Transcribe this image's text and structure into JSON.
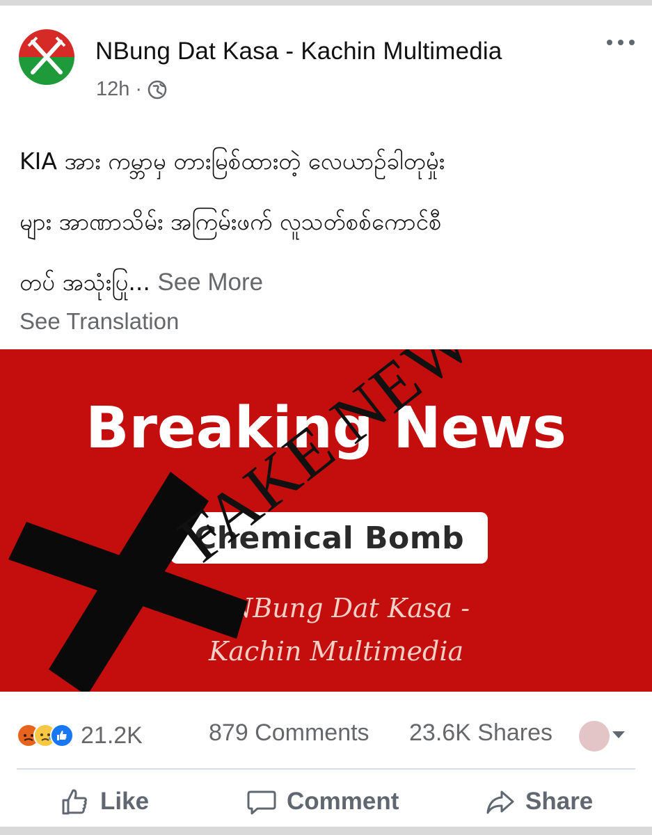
{
  "post": {
    "page_name": "NBung Dat Kasa - Kachin Multimedia",
    "time": "12h",
    "separator": "·",
    "text_lines": [
      "KIA အား ကမ္ဘာမှ တားမြစ်ထားတဲ့ လေယာဉ်ခါတုမှုံး",
      "များ အာဏာသိမ်း အကြမ်းဖက် လူသတ်စစ်ကောင်စီ",
      "တပ် အသုံးပြု..."
    ],
    "see_more": "See More",
    "see_translation": "See Translation"
  },
  "media": {
    "headline": "Breaking News",
    "pill_text": "Chemical Bomb",
    "credit_line1": "NBung Dat Kasa -",
    "credit_line2": "Kachin Multimedia",
    "stamp_text": "FAKE NEWS"
  },
  "stats": {
    "reactions_count": "21.2K",
    "comments": "879 Comments",
    "shares": "23.6K Shares",
    "reaction_icons": [
      "angry-reaction-icon",
      "sad-reaction-icon",
      "like-reaction-icon"
    ]
  },
  "actions": {
    "like": "Like",
    "comment": "Comment",
    "share": "Share"
  },
  "colors": {
    "banner_red": "#c40d0d",
    "secondary_text": "#65676b",
    "avatar_red": "#d62a26",
    "avatar_green": "#1e9a3a"
  }
}
